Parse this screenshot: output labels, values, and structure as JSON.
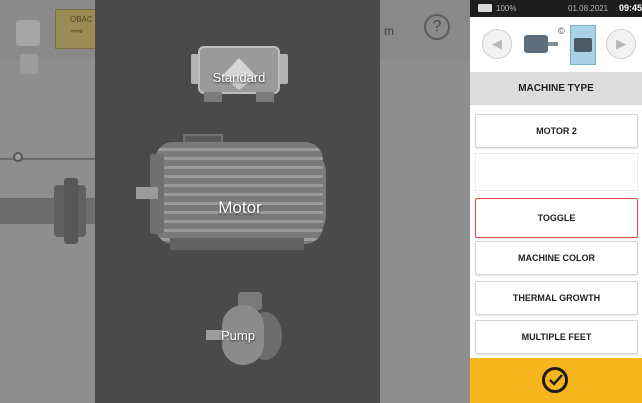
{
  "statusbar": {
    "battery_percent": "100%",
    "date": "01.08.2021",
    "time": "09:45"
  },
  "background": {
    "tag_text": "OBAC",
    "tag_arrow": "⟹",
    "fragment_text": "m",
    "help_symbol": "?"
  },
  "overlay": {
    "machines": {
      "standard": "Standard",
      "motor": "Motor",
      "pump": "Pump"
    }
  },
  "panel": {
    "nav_prev_symbol": "◀",
    "nav_next_symbol": "▶",
    "copy_symbol": "©",
    "heading": "MACHINE TYPE",
    "buttons": {
      "machine_name": "MOTOR 2",
      "toggle": "TOGGLE",
      "machine_color": "MACHINE COLOR",
      "thermal_growth": "THERMAL GROWTH",
      "multiple_feet": "MULTIPLE FEET"
    },
    "colors": {
      "confirm_bar": "#f5b51c",
      "highlight_border": "#e04a4a",
      "heading_bg": "#dcdcdc"
    }
  }
}
